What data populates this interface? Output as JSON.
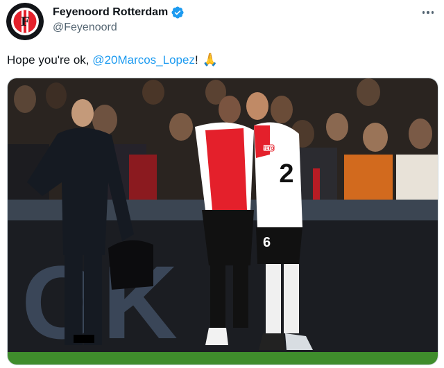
{
  "tweet": {
    "author": {
      "display_name": "Feyenoord Rotterdam",
      "handle": "@Feyenoord",
      "verified": true,
      "avatar_icon": "club-crest-icon",
      "avatar_text": "FEYENOORD ROTTERDAM",
      "avatar_letter": "F"
    },
    "text_before": "Hope you're ok,",
    "mention": "@20Marcos_Lopez",
    "text_after": "!",
    "emoji": "🙏",
    "media": {
      "board_letters": "OK",
      "shirt_numbers": [
        "2",
        "6"
      ],
      "shirt_sponsor": "TETO",
      "colors": {
        "red": "#e4202b",
        "pitch": "#3f8d2c",
        "navy": "#151a22",
        "mention": "#1d9bf0"
      }
    }
  }
}
